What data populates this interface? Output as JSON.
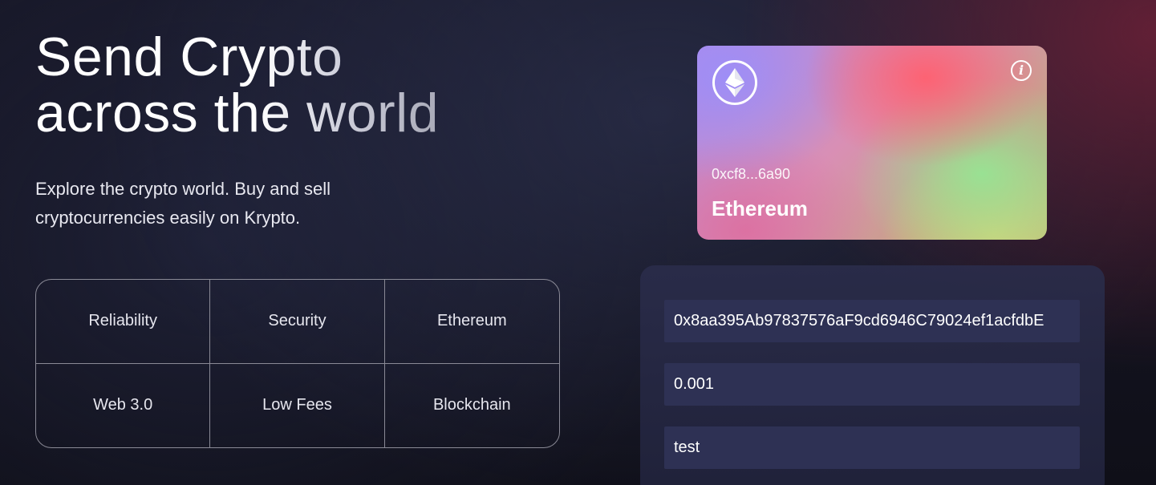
{
  "hero": {
    "headline_line1": "Send Crypto",
    "headline_line2": "across the world",
    "subtitle": "Explore the crypto world. Buy and sell cryptocurrencies easily on Krypto."
  },
  "features": [
    "Reliability",
    "Security",
    "Ethereum",
    "Web 3.0",
    "Low Fees",
    "Blockchain"
  ],
  "card": {
    "logo_icon": "ethereum-icon",
    "info_icon": "info-icon",
    "info_glyph": "i",
    "address": "0xcf8...6a90",
    "network": "Ethereum"
  },
  "form": {
    "address_value": "0x8aa395Ab97837576aF9cd6946C79024ef1acfdbE",
    "amount_value": "0.001",
    "keyword_value": "test"
  },
  "colors": {
    "background": "#13131f",
    "accent_red": "#7a223a",
    "panel": "#2a2c4a",
    "input": "#2e3154"
  }
}
